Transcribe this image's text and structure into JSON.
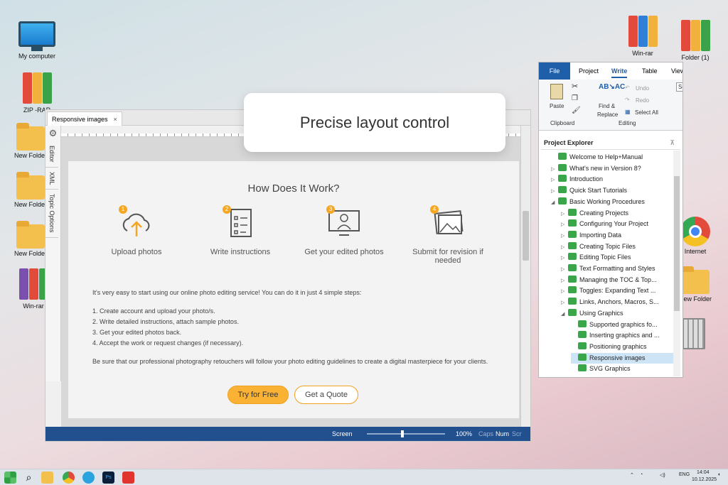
{
  "desktop": {
    "icons": [
      {
        "name": "my-computer",
        "label": "My computer"
      },
      {
        "name": "zip-rar",
        "label": "ZIP -RAR"
      },
      {
        "name": "new-folder-1",
        "label": "New Folder"
      },
      {
        "name": "new-folder-2",
        "label": "New Folder"
      },
      {
        "name": "new-folder-3",
        "label": "New Folder"
      },
      {
        "name": "win-rar-left",
        "label": "Win-rar"
      },
      {
        "name": "win-rar-right",
        "label": "Win-rar"
      },
      {
        "name": "folder-1",
        "label": "Folder (1)"
      },
      {
        "name": "internet",
        "label": "Internet"
      },
      {
        "name": "new-folder-right",
        "label": "New Folder"
      }
    ]
  },
  "editor": {
    "tab_label": "Responsive images",
    "close_glyph": "×",
    "side_tabs": [
      "Editor",
      "XML",
      "Topic Options"
    ],
    "page": {
      "heading": "How Does It Work?",
      "steps": [
        {
          "num": "1",
          "label": "Upload photos"
        },
        {
          "num": "2",
          "label": "Write instructions"
        },
        {
          "num": "3",
          "label": "Get your edited photos"
        },
        {
          "num": "4",
          "label": "Submit for revision if needed"
        }
      ],
      "intro": "It's very easy to start using our online photo editing service! You can do it in just 4 simple steps:",
      "list": [
        "1. Create account and upload your photo/s.",
        "2. Write detailed instructions, attach sample photos.",
        "3. Get your edited photos back.",
        "4. Accept the work or request changes (if necessary)."
      ],
      "closing": "Be sure that our professional photography retouchers will follow your photo editing guidelines to create a digital masterpiece for your clients.",
      "btn_try": "Try for Free",
      "btn_quote": "Get a Quote"
    },
    "status": {
      "screen": "Screen",
      "zoom": "100%",
      "caps": "Caps",
      "num": "Num",
      "scr": "Scr"
    }
  },
  "banner": {
    "text": "Precise layout control"
  },
  "ribbon": {
    "tabs": [
      "File",
      "Project",
      "Write",
      "Table",
      "View"
    ],
    "active_tab": "Write",
    "paste": "Paste",
    "clipboard": "Clipboard",
    "find_replace_1": "Find &",
    "find_replace_2": "Replace",
    "undo": "Undo",
    "redo": "Redo",
    "select_all": "Select All",
    "editing": "Editing",
    "extra": "Se"
  },
  "project_explorer": {
    "title": "Project Explorer",
    "items": [
      {
        "label": "Welcome to Help+Manual",
        "level": 0,
        "arrow": ""
      },
      {
        "label": "What's new in Version 8?",
        "level": 0,
        "arrow": "▷"
      },
      {
        "label": "Introduction",
        "level": 0,
        "arrow": "▷"
      },
      {
        "label": "Quick Start Tutorials",
        "level": 0,
        "arrow": "▷"
      },
      {
        "label": "Basic Working Procedures",
        "level": 0,
        "arrow": "◢"
      },
      {
        "label": "Creating Projects",
        "level": 1,
        "arrow": "▷"
      },
      {
        "label": "Configuring Your Project",
        "level": 1,
        "arrow": "▷"
      },
      {
        "label": "Importing Data",
        "level": 1,
        "arrow": "▷"
      },
      {
        "label": "Creating Topic Files",
        "level": 1,
        "arrow": "▷"
      },
      {
        "label": "Editing Topic Files",
        "level": 1,
        "arrow": "▷"
      },
      {
        "label": "Text Formatting and Styles",
        "level": 1,
        "arrow": "▷"
      },
      {
        "label": "Managing the TOC & Top...",
        "level": 1,
        "arrow": "▷"
      },
      {
        "label": "Toggles: Expanding Text ...",
        "level": 1,
        "arrow": "▷"
      },
      {
        "label": "Links, Anchors, Macros, S...",
        "level": 1,
        "arrow": "▷"
      },
      {
        "label": "Using Graphics",
        "level": 1,
        "arrow": "◢"
      },
      {
        "label": "Supported graphics fo...",
        "level": 2,
        "arrow": ""
      },
      {
        "label": "Inserting graphics and ...",
        "level": 2,
        "arrow": ""
      },
      {
        "label": "Positioning graphics",
        "level": 2,
        "arrow": ""
      },
      {
        "label": "Responsive images",
        "level": 2,
        "arrow": "",
        "selected": true
      },
      {
        "label": "SVG Graphics",
        "level": 2,
        "arrow": ""
      }
    ]
  },
  "taskbar": {
    "lang": "ENG",
    "time": "14:04",
    "date": "10.12.2025",
    "apps": [
      "widgets",
      "search",
      "file-explorer",
      "chrome",
      "telegram",
      "photoshop",
      "acrobat"
    ]
  },
  "colors": {
    "accent": "#1f5ea8",
    "orange": "#f9b233",
    "status": "#22508e"
  }
}
